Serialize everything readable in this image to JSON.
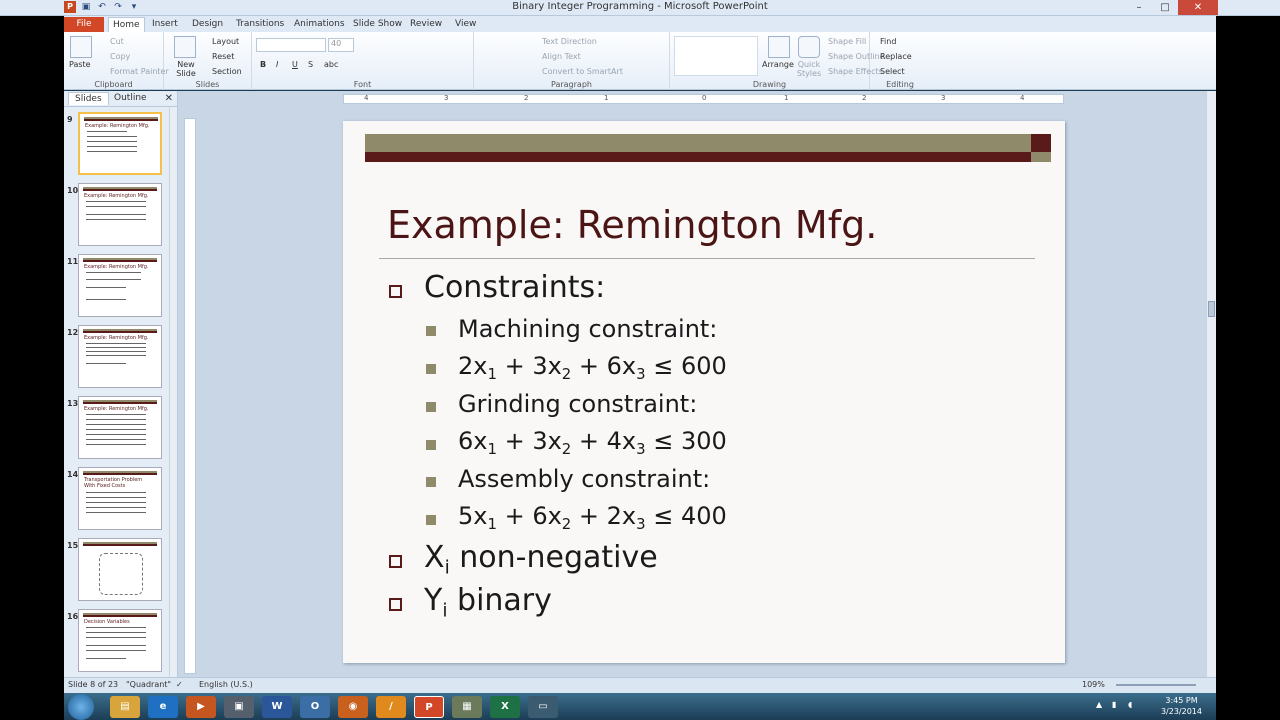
{
  "window": {
    "title": "Binary Integer Programming - Microsoft PowerPoint"
  },
  "ribbon_tabs": [
    "File",
    "Home",
    "Insert",
    "Design",
    "Transitions",
    "Animations",
    "Slide Show",
    "Review",
    "View"
  ],
  "ribbon": {
    "clipboard": {
      "label": "Clipboard",
      "paste": "Paste",
      "cut": "Cut",
      "copy": "Copy",
      "format_painter": "Format Painter"
    },
    "slides": {
      "label": "Slides",
      "new_slide": "New Slide",
      "layout": "Layout",
      "reset": "Reset",
      "section": "Section"
    },
    "font": {
      "label": "Font",
      "size": "40",
      "bold": "B",
      "italic": "I",
      "underline": "U",
      "strike": "S",
      "shadow": "abc"
    },
    "paragraph": {
      "label": "Paragraph",
      "text_direction": "Text Direction",
      "align_text": "Align Text",
      "convert_smartart": "Convert to SmartArt"
    },
    "drawing": {
      "label": "Drawing",
      "arrange": "Arrange",
      "quick_styles": "Quick Styles",
      "shape_fill": "Shape Fill",
      "shape_outline": "Shape Outline",
      "shape_effects": "Shape Effects"
    },
    "editing": {
      "label": "Editing",
      "find": "Find",
      "replace": "Replace",
      "select": "Select"
    }
  },
  "left_panel": {
    "tabs": [
      "Slides",
      "Outline"
    ],
    "thumbs": [
      {
        "num": "9",
        "title": "Example: Remington Mfg."
      },
      {
        "num": "10",
        "title": "Example: Remington Mfg."
      },
      {
        "num": "11",
        "title": "Example: Remington Mfg."
      },
      {
        "num": "12",
        "title": "Example: Remington Mfg."
      },
      {
        "num": "13",
        "title": "Example: Remington Mfg."
      },
      {
        "num": "14",
        "title": "Transportation Problem With Fixed Costs"
      },
      {
        "num": "15",
        "title": ""
      },
      {
        "num": "16",
        "title": "Decision Variables"
      }
    ]
  },
  "ruler": [
    "4",
    "3",
    "2",
    "1",
    "0",
    "1",
    "2",
    "3",
    "4"
  ],
  "slide": {
    "title": "Example: Remington Mfg.",
    "l1_constraints": "Constraints:",
    "machining_label": "Machining constraint:",
    "machining_eq": {
      "a": "2x",
      "s1": "1",
      "b": " + 3x",
      "s2": "2",
      "c": " + 6x",
      "s3": "3",
      "d": " ≤ 600"
    },
    "grinding_label": "Grinding constraint:",
    "grinding_eq": {
      "a": "6x",
      "s1": "1",
      "b": " + 3x",
      "s2": "2",
      "c": " + 4x",
      "s3": "3",
      "d": " ≤ 300"
    },
    "assembly_label": "Assembly constraint:",
    "assembly_eq": {
      "a": "5x",
      "s1": "1",
      "b": " + 6x",
      "s2": "2",
      "c": " + 2x",
      "s3": "3",
      "d": " ≤ 400"
    },
    "xi": {
      "a": "X",
      "s": "i",
      "b": " non-negative"
    },
    "yi": {
      "a": "Y",
      "s": "i",
      "b": " binary"
    }
  },
  "status": {
    "slide": "Slide 8 of 23",
    "theme": "\"Quadrant\"",
    "language": "English (U.S.)",
    "zoom": "109%"
  },
  "clock": {
    "time": "3:45 PM",
    "date": "3/23/2014"
  },
  "colors": {
    "title": "#4b1515",
    "olive": "#8f8a6a",
    "maroon": "#5a1a1a"
  }
}
